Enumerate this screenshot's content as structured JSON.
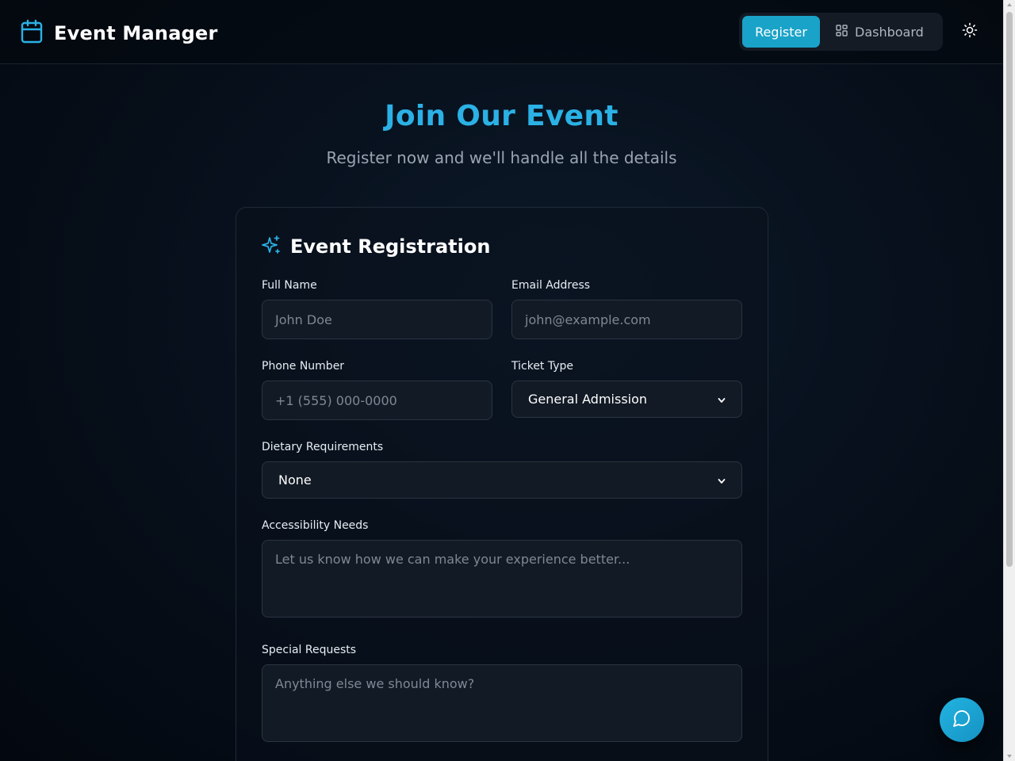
{
  "app": {
    "title": "Event Manager"
  },
  "nav": {
    "register_label": "Register",
    "dashboard_label": "Dashboard"
  },
  "icons": {
    "brand": "calendar-icon",
    "dashboard": "grid-icon",
    "theme": "sun-icon",
    "card": "sparkles-icon",
    "chat": "chat-bubble-icon"
  },
  "colors": {
    "accent": "#1aa3c8",
    "heading": "#2bb1e5",
    "background": "#07101c"
  },
  "hero": {
    "title": "Join Our Event",
    "subtitle": "Register now and we'll handle all the details"
  },
  "form": {
    "title": "Event Registration",
    "full_name": {
      "label": "Full Name",
      "placeholder": "John Doe"
    },
    "email": {
      "label": "Email Address",
      "placeholder": "john@example.com"
    },
    "phone": {
      "label": "Phone Number",
      "placeholder": "+1 (555) 000-0000"
    },
    "ticket_type": {
      "label": "Ticket Type",
      "value": "General Admission"
    },
    "dietary": {
      "label": "Dietary Requirements",
      "value": "None"
    },
    "accessibility": {
      "label": "Accessibility Needs",
      "placeholder": "Let us know how we can make your experience better..."
    },
    "special_requests": {
      "label": "Special Requests",
      "placeholder": "Anything else we should know?"
    }
  }
}
